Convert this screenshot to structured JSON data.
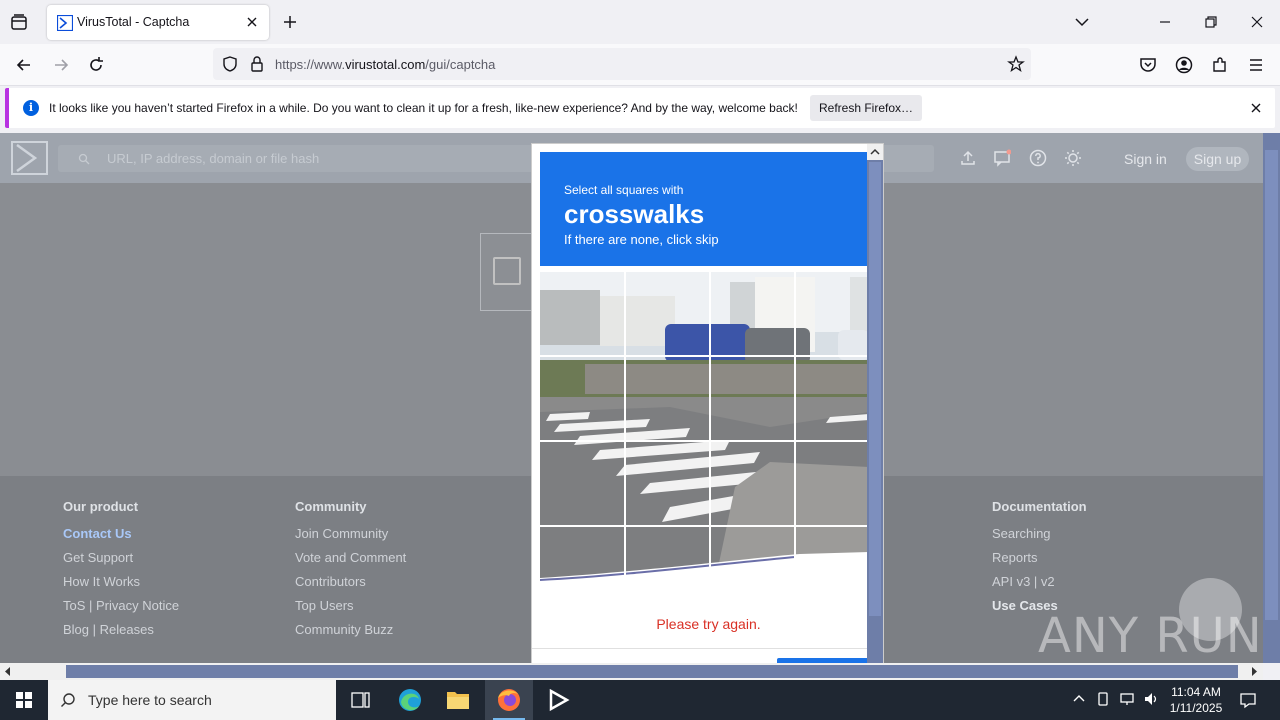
{
  "browser": {
    "tab_title": "VirusTotal - Captcha",
    "url_prefix": "https://www.",
    "url_host": "virustotal.com",
    "url_path": "/gui/captcha",
    "notification_text": "It looks like you haven’t started Firefox in a while. Do you want to clean it up for a fresh, like-new experience? And by the way, welcome back!",
    "notification_button": "Refresh Firefox…"
  },
  "vt": {
    "search_placeholder": "URL, IP address, domain or file hash",
    "sign_in": "Sign in",
    "sign_up": "Sign up",
    "footer": {
      "col1": {
        "title": "Our product",
        "links": [
          "Contact Us",
          "Get Support",
          "How It Works",
          "ToS | Privacy Notice",
          "Blog | Releases"
        ]
      },
      "col2": {
        "title": "Community",
        "links": [
          "Join Community",
          "Vote and Comment",
          "Contributors",
          "Top Users",
          "Community Buzz"
        ]
      },
      "col3": {
        "title": "Documentation",
        "links": [
          "Searching",
          "Reports",
          "API v3 | v2",
          "Use Cases"
        ]
      }
    }
  },
  "captcha": {
    "select_text": "Select all squares with",
    "target_word": "crosswalks",
    "skip_text": "If there are none, click skip",
    "error_text": "Please try again.",
    "header_color": "#1a73e8",
    "error_color": "#d93025"
  },
  "watermark": "ANY RUN",
  "taskbar": {
    "search_placeholder": "Type here to search",
    "time": "11:04 AM",
    "date": "1/11/2025"
  }
}
